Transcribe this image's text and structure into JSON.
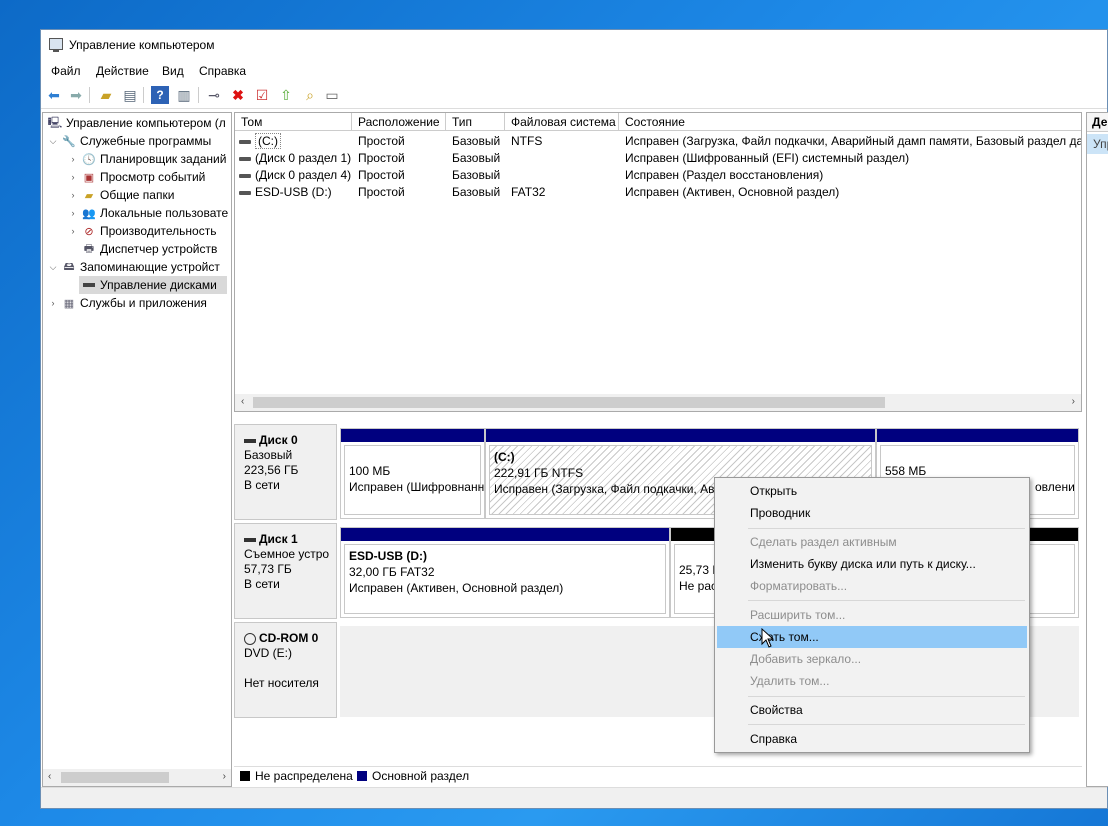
{
  "window": {
    "title": "Управление компьютером"
  },
  "menu": [
    "Файл",
    "Действие",
    "Вид",
    "Справка"
  ],
  "toolbar_icons": [
    "back-arrow-icon",
    "forward-arrow-icon",
    "up-folder-icon",
    "show-tree-icon",
    "help-icon",
    "action-pane-icon",
    "connect-icon",
    "delete-icon",
    "check-icon",
    "up-icon",
    "search-folder-icon",
    "properties-icon"
  ],
  "tree": {
    "items": [
      {
        "label": "Управление компьютером (л",
        "icon": "computer-icon"
      },
      {
        "label": "Служебные программы",
        "icon": "tools-icon"
      },
      {
        "label": "Планировщик заданий",
        "icon": "clock-icon"
      },
      {
        "label": "Просмотр событий",
        "icon": "event-icon"
      },
      {
        "label": "Общие папки",
        "icon": "shared-folder-icon"
      },
      {
        "label": "Локальные пользовате",
        "icon": "users-icon"
      },
      {
        "label": "Производительность",
        "icon": "performance-icon"
      },
      {
        "label": "Диспетчер устройств",
        "icon": "device-icon"
      },
      {
        "label": "Запоминающие устройст",
        "icon": "storage-icon"
      },
      {
        "label": "Управление дисками",
        "icon": "disk-icon"
      },
      {
        "label": "Службы и приложения",
        "icon": "services-icon"
      }
    ]
  },
  "volumes": {
    "headers": [
      "Том",
      "Расположение",
      "Тип",
      "Файловая система",
      "Состояние"
    ],
    "rows": [
      [
        "(C:)",
        "Простой",
        "Базовый",
        "NTFS",
        "Исправен (Загрузка, Файл подкачки, Аварийный дамп памяти, Базовый раздел дан"
      ],
      [
        "(Диск 0 раздел 1)",
        "Простой",
        "Базовый",
        "",
        "Исправен (Шифрованный (EFI) системный раздел)"
      ],
      [
        "(Диск 0 раздел 4)",
        "Простой",
        "Базовый",
        "",
        "Исправен (Раздел восстановления)"
      ],
      [
        "ESD-USB (D:)",
        "Простой",
        "Базовый",
        "FAT32",
        "Исправен (Активен, Основной раздел)"
      ]
    ]
  },
  "disks": [
    {
      "name": "Диск 0",
      "type": "Базовый",
      "size": "223,56 ГБ",
      "status": "В сети"
    },
    {
      "name": "Диск 1",
      "type": "Съемное устро",
      "size": "57,73 ГБ",
      "status": "В сети"
    },
    {
      "name": "CD-ROM 0",
      "type": "DVD (E:)",
      "size": "",
      "status": "Нет носителя"
    }
  ],
  "partitions": {
    "d0p1": {
      "line1": "100 МБ",
      "line2": "Исправен (Шифровнанн"
    },
    "d0p2": {
      "title": "(C:)",
      "line1": "222,91 ГБ NTFS",
      "line2": "Исправен (Загрузка, Файл подкачки, Ава"
    },
    "d0p3": {
      "line1": "558 МБ",
      "line2": "овлени"
    },
    "d1p1": {
      "title": "ESD-USB  (D:)",
      "line1": "32,00 ГБ FAT32",
      "line2": "Исправен (Активен, Основной раздел)"
    },
    "d1p2": {
      "line1": "25,73 Г",
      "line2": "Не рас"
    }
  },
  "legend": {
    "unallocated": "Не распределена",
    "primary": "Основной раздел"
  },
  "right_pane": {
    "header": "Де",
    "item": "Упр"
  },
  "context_menu": {
    "open": "Открыть",
    "explorer": "Проводник",
    "mark_active": "Сделать раздел активным",
    "change_letter": "Изменить букву диска или путь к диску...",
    "format": "Форматировать...",
    "extend": "Расширить том...",
    "shrink": "Сжать том...",
    "add_mirror": "Добавить зеркало...",
    "delete": "Удалить том...",
    "properties": "Свойства",
    "help": "Справка"
  },
  "colors": {
    "primary_partition": "#00007f",
    "unallocated": "#000000",
    "highlight": "#91c9f7"
  }
}
